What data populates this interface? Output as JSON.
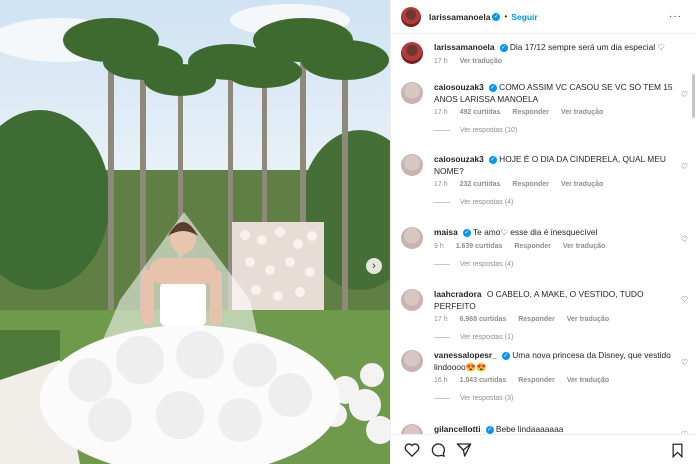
{
  "header": {
    "username": "larissamanoela",
    "separator": "•",
    "follow_label": "Seguir",
    "more_label": "···"
  },
  "caption": {
    "username": "larissamanoela",
    "text": "Dia 17/12 sempre será um dia especial ♡",
    "time": "17 h",
    "translate": "Ver tradução"
  },
  "comments": [
    {
      "username": "caiosouzak3",
      "text": "COMO ASSIM VC CASOU SE VC SÓ TEM 15 ANOS LARISSA MANOELA",
      "time": "17 h",
      "likes": "492 curtidas",
      "reply": "Responder",
      "translate": "Ver tradução",
      "replies": "Ver respostas (10)"
    },
    {
      "username": "caiosouzak3",
      "text": "HOJE É O DIA DA CINDERELA, QUAL MEU NOME?",
      "time": "17 h",
      "likes": "232 curtidas",
      "reply": "Responder",
      "translate": "Ver tradução",
      "replies": "Ver respostas (4)"
    },
    {
      "username": "maisa",
      "text": "Te amo♡ esse dia é inesquecível",
      "time": "9 h",
      "likes": "1.639 curtidas",
      "reply": "Responder",
      "translate": "Ver tradução",
      "replies": "Ver respostas (4)"
    },
    {
      "username": "laahcradora",
      "text": "O CABELO, A MAKE, O VESTIDO, TUDO PERFEITO",
      "time": "17 h",
      "likes": "6.968 curtidas",
      "reply": "Responder",
      "translate": "Ver tradução",
      "replies": "Ver respostas (1)"
    },
    {
      "username": "vanessalopesr_",
      "text": "Uma nova princesa da Disney, que vestido lindoooo😍😍",
      "time": "16 h",
      "likes": "1.043 curtidas",
      "reply": "Responder",
      "translate": "Ver tradução",
      "replies": "Ver respostas (3)"
    },
    {
      "username": "gilancellotti",
      "text": "Bebe lindaaaaaaa"
    }
  ],
  "icons": {
    "verified": "verified-badge-icon",
    "heart": "heart-icon",
    "comment": "comment-icon",
    "share": "share-icon",
    "bookmark": "bookmark-icon",
    "next": "chevron-right-icon"
  },
  "colors": {
    "accent": "#0095f6",
    "muted": "#8e8e8e",
    "text": "#262626"
  }
}
